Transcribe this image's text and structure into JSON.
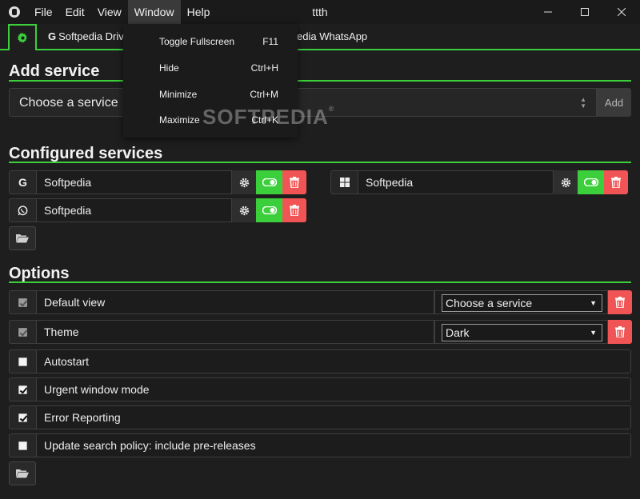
{
  "window": {
    "title": "ttth",
    "menu": [
      "File",
      "Edit",
      "View",
      "Window",
      "Help"
    ]
  },
  "tabs": {
    "items": [
      {
        "label": "Softpedia Driv",
        "icon": "google-g"
      },
      {
        "label": "edia WhatsApp",
        "icon": "none"
      }
    ]
  },
  "add_service": {
    "heading": "Add service",
    "placeholder": "Choose a service",
    "add_label": "Add"
  },
  "configured": {
    "heading": "Configured services",
    "services": [
      {
        "name": "Softpedia",
        "icon": "google-icon",
        "enabled": true
      },
      {
        "name": "Softpedia",
        "icon": "windows-icon",
        "enabled": true
      },
      {
        "name": "Softpedia",
        "icon": "whatsapp-icon",
        "enabled": true
      }
    ]
  },
  "options": {
    "heading": "Options",
    "items": [
      {
        "label": "Default view",
        "checked": true,
        "disabled": true,
        "select": "Choose a service"
      },
      {
        "label": "Theme",
        "checked": true,
        "disabled": true,
        "select": "Dark"
      },
      {
        "label": "Autostart",
        "checked": false
      },
      {
        "label": "Urgent window mode",
        "checked": true
      },
      {
        "label": "Error Reporting",
        "checked": true
      },
      {
        "label": "Update search policy: include pre-releases",
        "checked": false
      }
    ]
  },
  "window_menu": {
    "items": [
      {
        "label": "Toggle Fullscreen",
        "accel": "F11"
      },
      {
        "label": "Hide",
        "accel": "Ctrl+H"
      },
      {
        "label": "Minimize",
        "accel": "Ctrl+M"
      },
      {
        "label": "Maximize",
        "accel": "Ctrl+K"
      }
    ]
  },
  "watermark": "SOFTPEDIA",
  "colors": {
    "accent": "#3ccf3c",
    "danger": "#f05454",
    "background": "#1e1e1e"
  }
}
